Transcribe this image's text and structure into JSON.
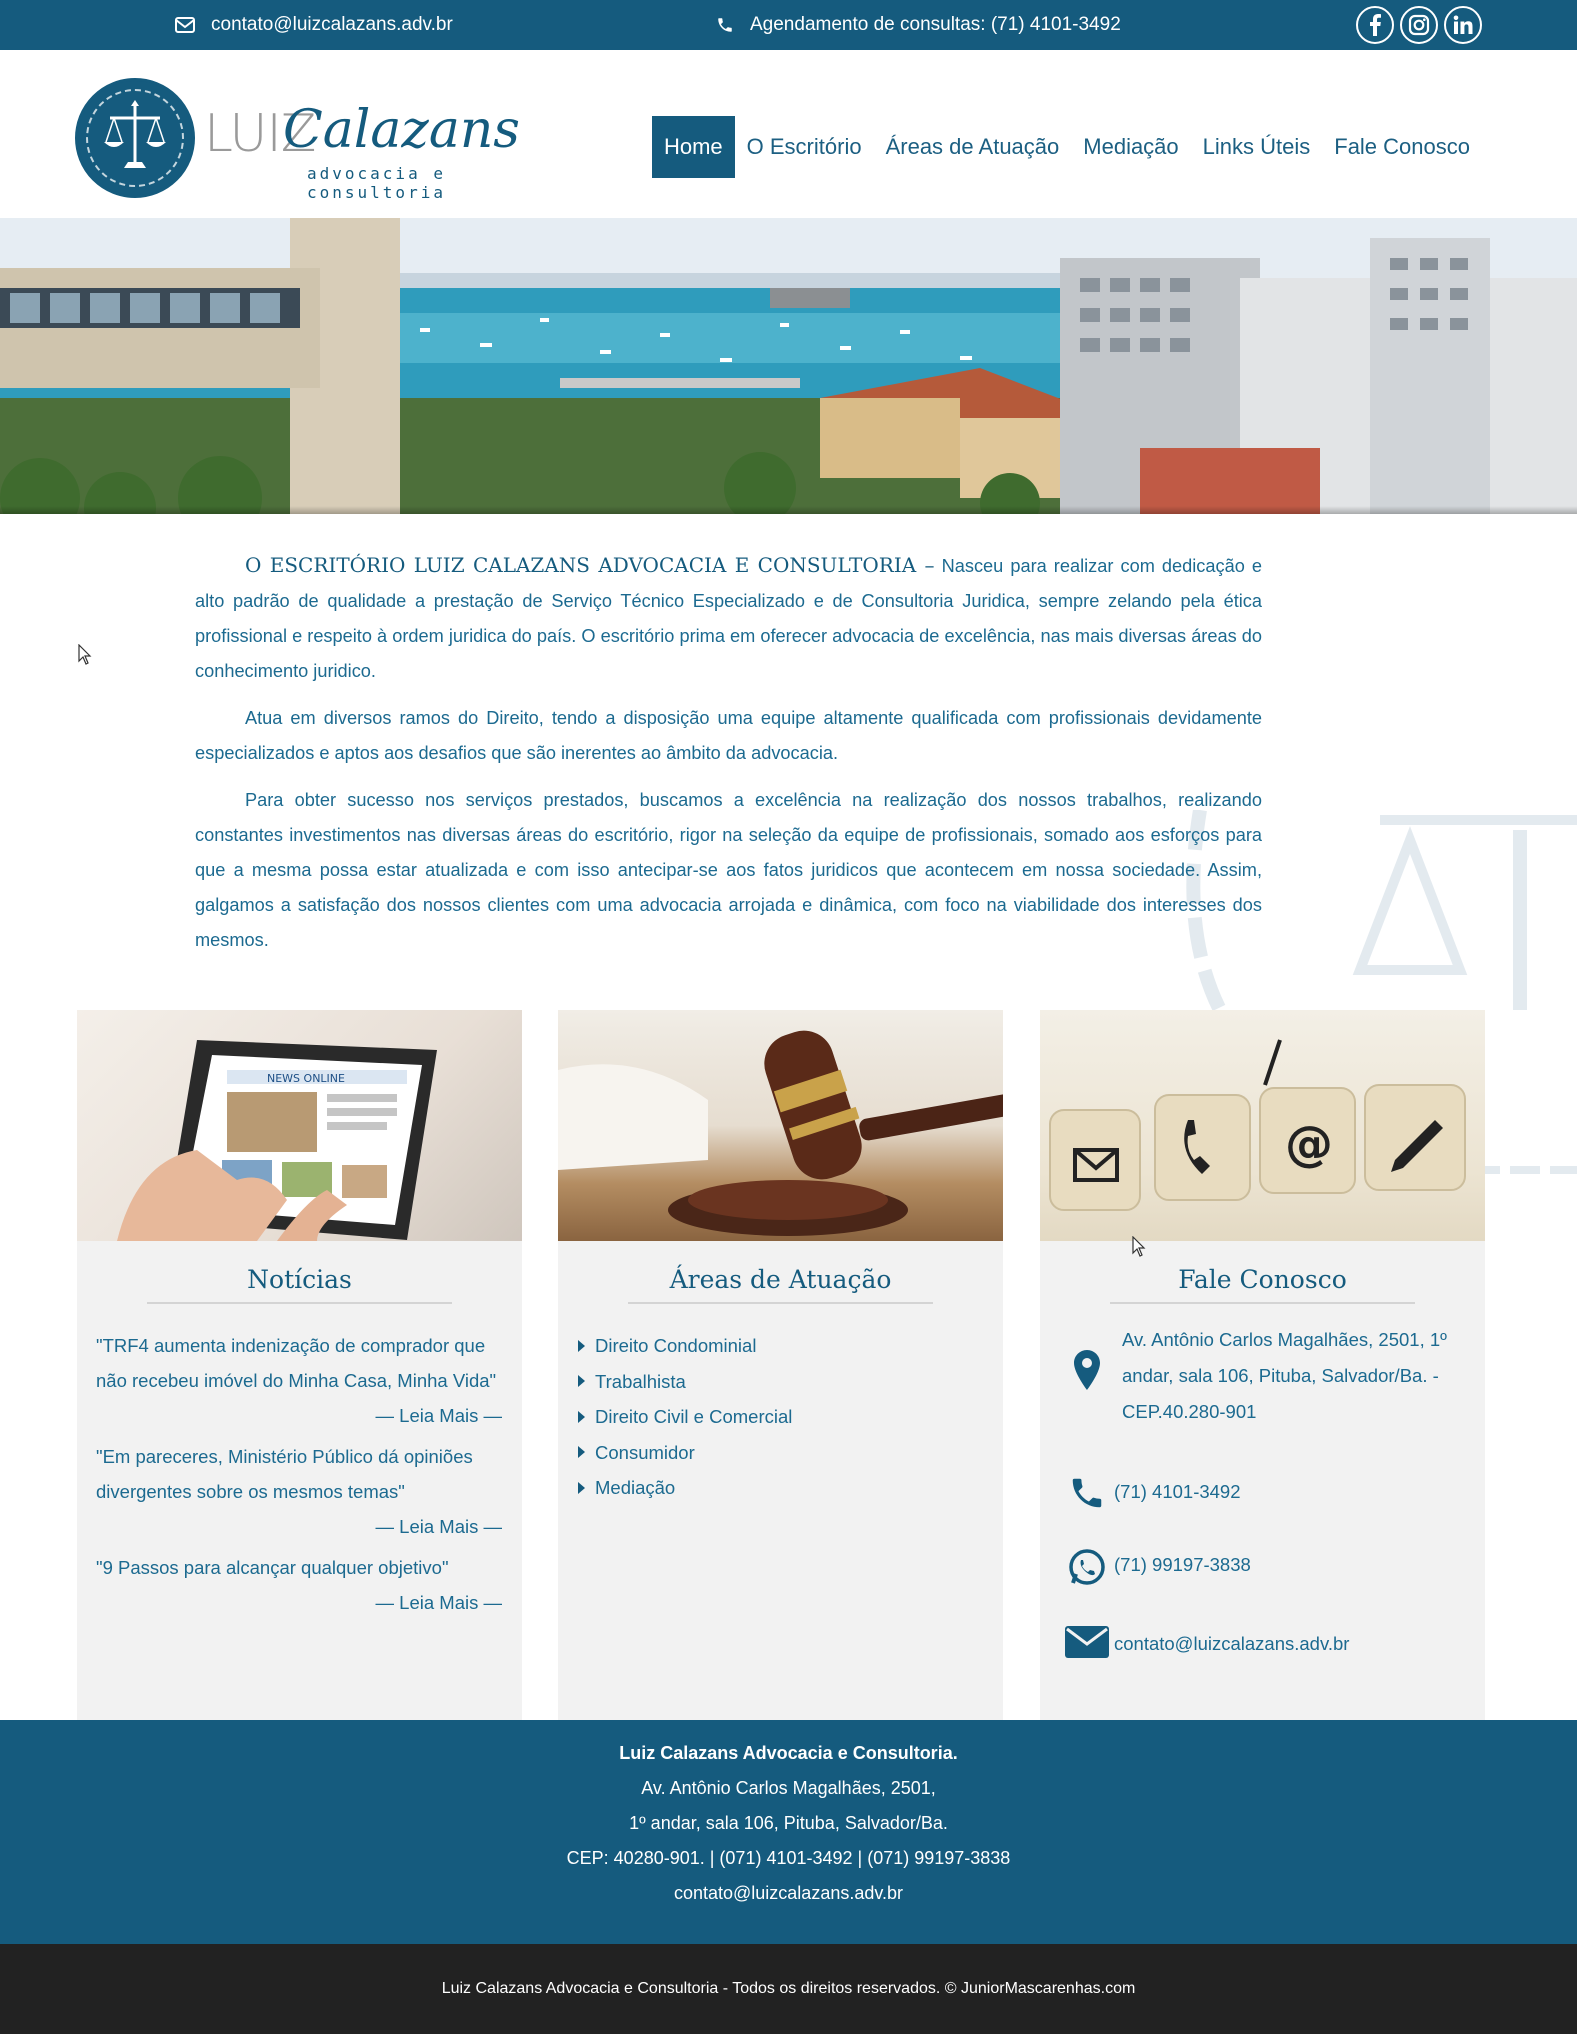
{
  "topbar": {
    "email": "contato@luizcalazans.adv.br",
    "phone": "Agendamento de consultas: (71) 4101-3492",
    "social": [
      "facebook-icon",
      "instagram-icon",
      "linkedin-icon"
    ]
  },
  "logo": {
    "first": "LUIZ",
    "last": "Calazans",
    "tagline": "advocacia e consultoria"
  },
  "nav": {
    "items": [
      "Home",
      "O Escritório",
      "Áreas de Atuação",
      "Mediação",
      "Links Úteis",
      "Fale Conosco"
    ],
    "active": "Home"
  },
  "intro": {
    "lead": "O ESCRITÓRIO LUIZ CALAZANS ADVOCACIA E CONSULTORIA –",
    "p1": "Nasceu para realizar com dedicação e alto padrão de qualidade a prestação de Serviço Técnico Especializado e de Consultoria Juridica, sempre zelando pela ética profissional e respeito à ordem juridica do país. O escritório prima em oferecer advocacia de excelência, nas mais diversas áreas do conhecimento juridico.",
    "p2": "Atua em diversos ramos do Direito, tendo a disposição uma equipe altamente qualificada com profissionais devidamente especializados e aptos aos desafios que são inerentes ao âmbito da advocacia.",
    "p3": "Para obter sucesso nos serviços prestados, buscamos a excelência na realização dos nossos trabalhos, realizando constantes investimentos nas diversas áreas do escritório, rigor na seleção da equipe de profissionais, somado aos esforços para que a mesma possa estar atualizada e com isso antecipar-se aos fatos juridicos que acontecem em nossa sociedade. Assim, galgamos a satisfação dos nossos clientes com uma advocacia arrojada e dinâmica, com foco na viabilidade dos interesses dos mesmos."
  },
  "cards": {
    "news": {
      "title": "Notícias",
      "items": [
        "\"TRF4 aumenta indenização de comprador que não recebeu imóvel do Minha Casa, Minha Vida\"",
        "\"Em pareceres, Ministério Público dá opiniões divergentes sobre os mesmos temas\"",
        "\"9 Passos para alcançar qualquer objetivo\""
      ],
      "more": "— Leia Mais —",
      "tablet_text": "NEWS ONLINE"
    },
    "areas": {
      "title": "Áreas de Atuação",
      "items": [
        "Direito Condominial",
        "Trabalhista",
        "Direito Civil e Comercial",
        "Consumidor",
        "Mediação"
      ]
    },
    "contact": {
      "title": "Fale Conosco",
      "address": "Av. Antônio Carlos Magalhães, 2501, 1º andar, sala 106, Pituba, Salvador/Ba. - CEP.40.280-901",
      "phone": "(71) 4101-3492",
      "whatsapp": "(71) 99197-3838",
      "email": "contato@luizcalazans.adv.br",
      "key_icons": [
        "envelope-icon",
        "phone-icon",
        "at-icon",
        "pencil-icon"
      ]
    }
  },
  "footer": {
    "name": "Luiz Calazans Advocacia e Consultoria.",
    "line1": "Av. Antônio Carlos Magalhães, 2501,",
    "line2": "1º andar, sala 106, Pituba, Salvador/Ba.",
    "line3": "CEP: 40280-901. | (071) 4101-3492 | (071) 99197-3838",
    "email": "contato@luizcalazans.adv.br"
  },
  "copyright": "Luiz Calazans Advocacia e Consultoria - Todos os direitos reservados. © JuniorMascarenhas.com",
  "colors": {
    "primary": "#155b7e",
    "text": "#1c6a90",
    "card_bg": "#f2f2f2",
    "copy_bg": "#222222"
  }
}
